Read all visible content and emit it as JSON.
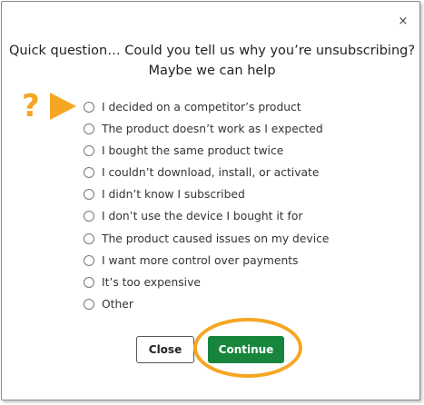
{
  "dialog": {
    "close_glyph": "×",
    "title": "Quick question… Could you tell us why you’re unsubscribing? Maybe we can help"
  },
  "hint": {
    "question_mark": "?",
    "color": "#f5a623"
  },
  "options": [
    {
      "label": "I decided on a competitor’s product"
    },
    {
      "label": "The product doesn’t work as I expected"
    },
    {
      "label": "I bought the same product twice"
    },
    {
      "label": "I couldn’t download, install, or activate"
    },
    {
      "label": "I didn’t know I subscribed"
    },
    {
      "label": "I don’t use the device I bought it for"
    },
    {
      "label": "The product caused issues on my device"
    },
    {
      "label": "I want more control over payments"
    },
    {
      "label": "It’s too expensive"
    },
    {
      "label": "Other"
    }
  ],
  "buttons": {
    "close_label": "Close",
    "continue_label": "Continue",
    "continue_color": "#17853c",
    "highlight_color": "#f5a623"
  }
}
